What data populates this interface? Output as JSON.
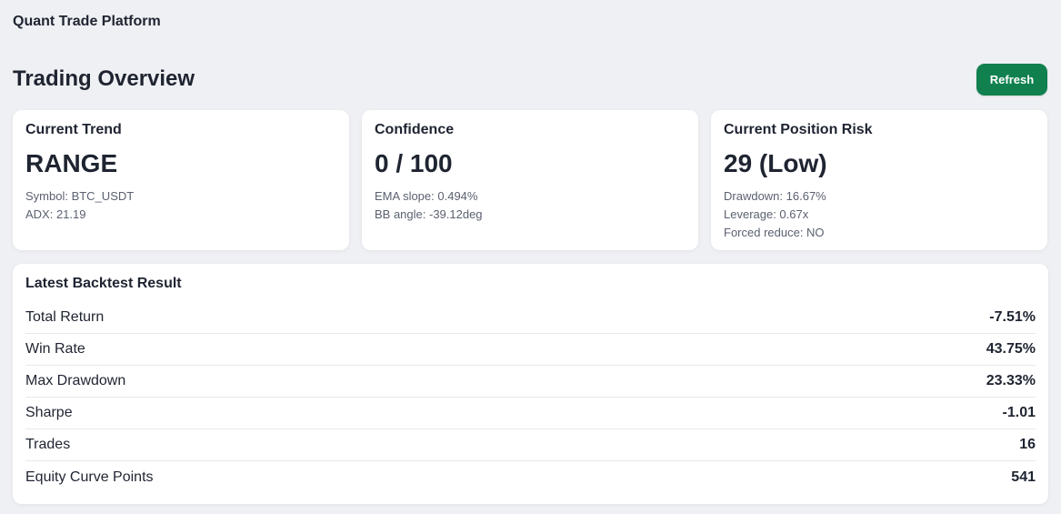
{
  "header": {
    "app_title": "Quant Trade Platform"
  },
  "main": {
    "page_title": "Trading Overview",
    "refresh_label": "Refresh"
  },
  "cards": {
    "trend": {
      "title": "Current Trend",
      "value": "RANGE",
      "lines": [
        "Symbol: BTC_USDT",
        "ADX: 21.19"
      ]
    },
    "confidence": {
      "title": "Confidence",
      "value": "0 / 100",
      "lines": [
        "EMA slope: 0.494%",
        "BB angle: -39.12deg"
      ]
    },
    "risk": {
      "title": "Current Position Risk",
      "value": "29 (Low)",
      "lines": [
        "Drawdown: 16.67%",
        "Leverage: 0.67x",
        "Forced reduce: NO"
      ]
    }
  },
  "backtest": {
    "title": "Latest Backtest Result",
    "rows": [
      {
        "label": "Total Return",
        "value": "-7.51%"
      },
      {
        "label": "Win Rate",
        "value": "43.75%"
      },
      {
        "label": "Max Drawdown",
        "value": "23.33%"
      },
      {
        "label": "Sharpe",
        "value": "-1.01"
      },
      {
        "label": "Trades",
        "value": "16"
      },
      {
        "label": "Equity Curve Points",
        "value": "541"
      }
    ]
  },
  "colors": {
    "background": "#eff0f3",
    "card": "#ffffff",
    "accent": "#10804f",
    "text": "#1f2431",
    "muted": "#5b6170"
  }
}
